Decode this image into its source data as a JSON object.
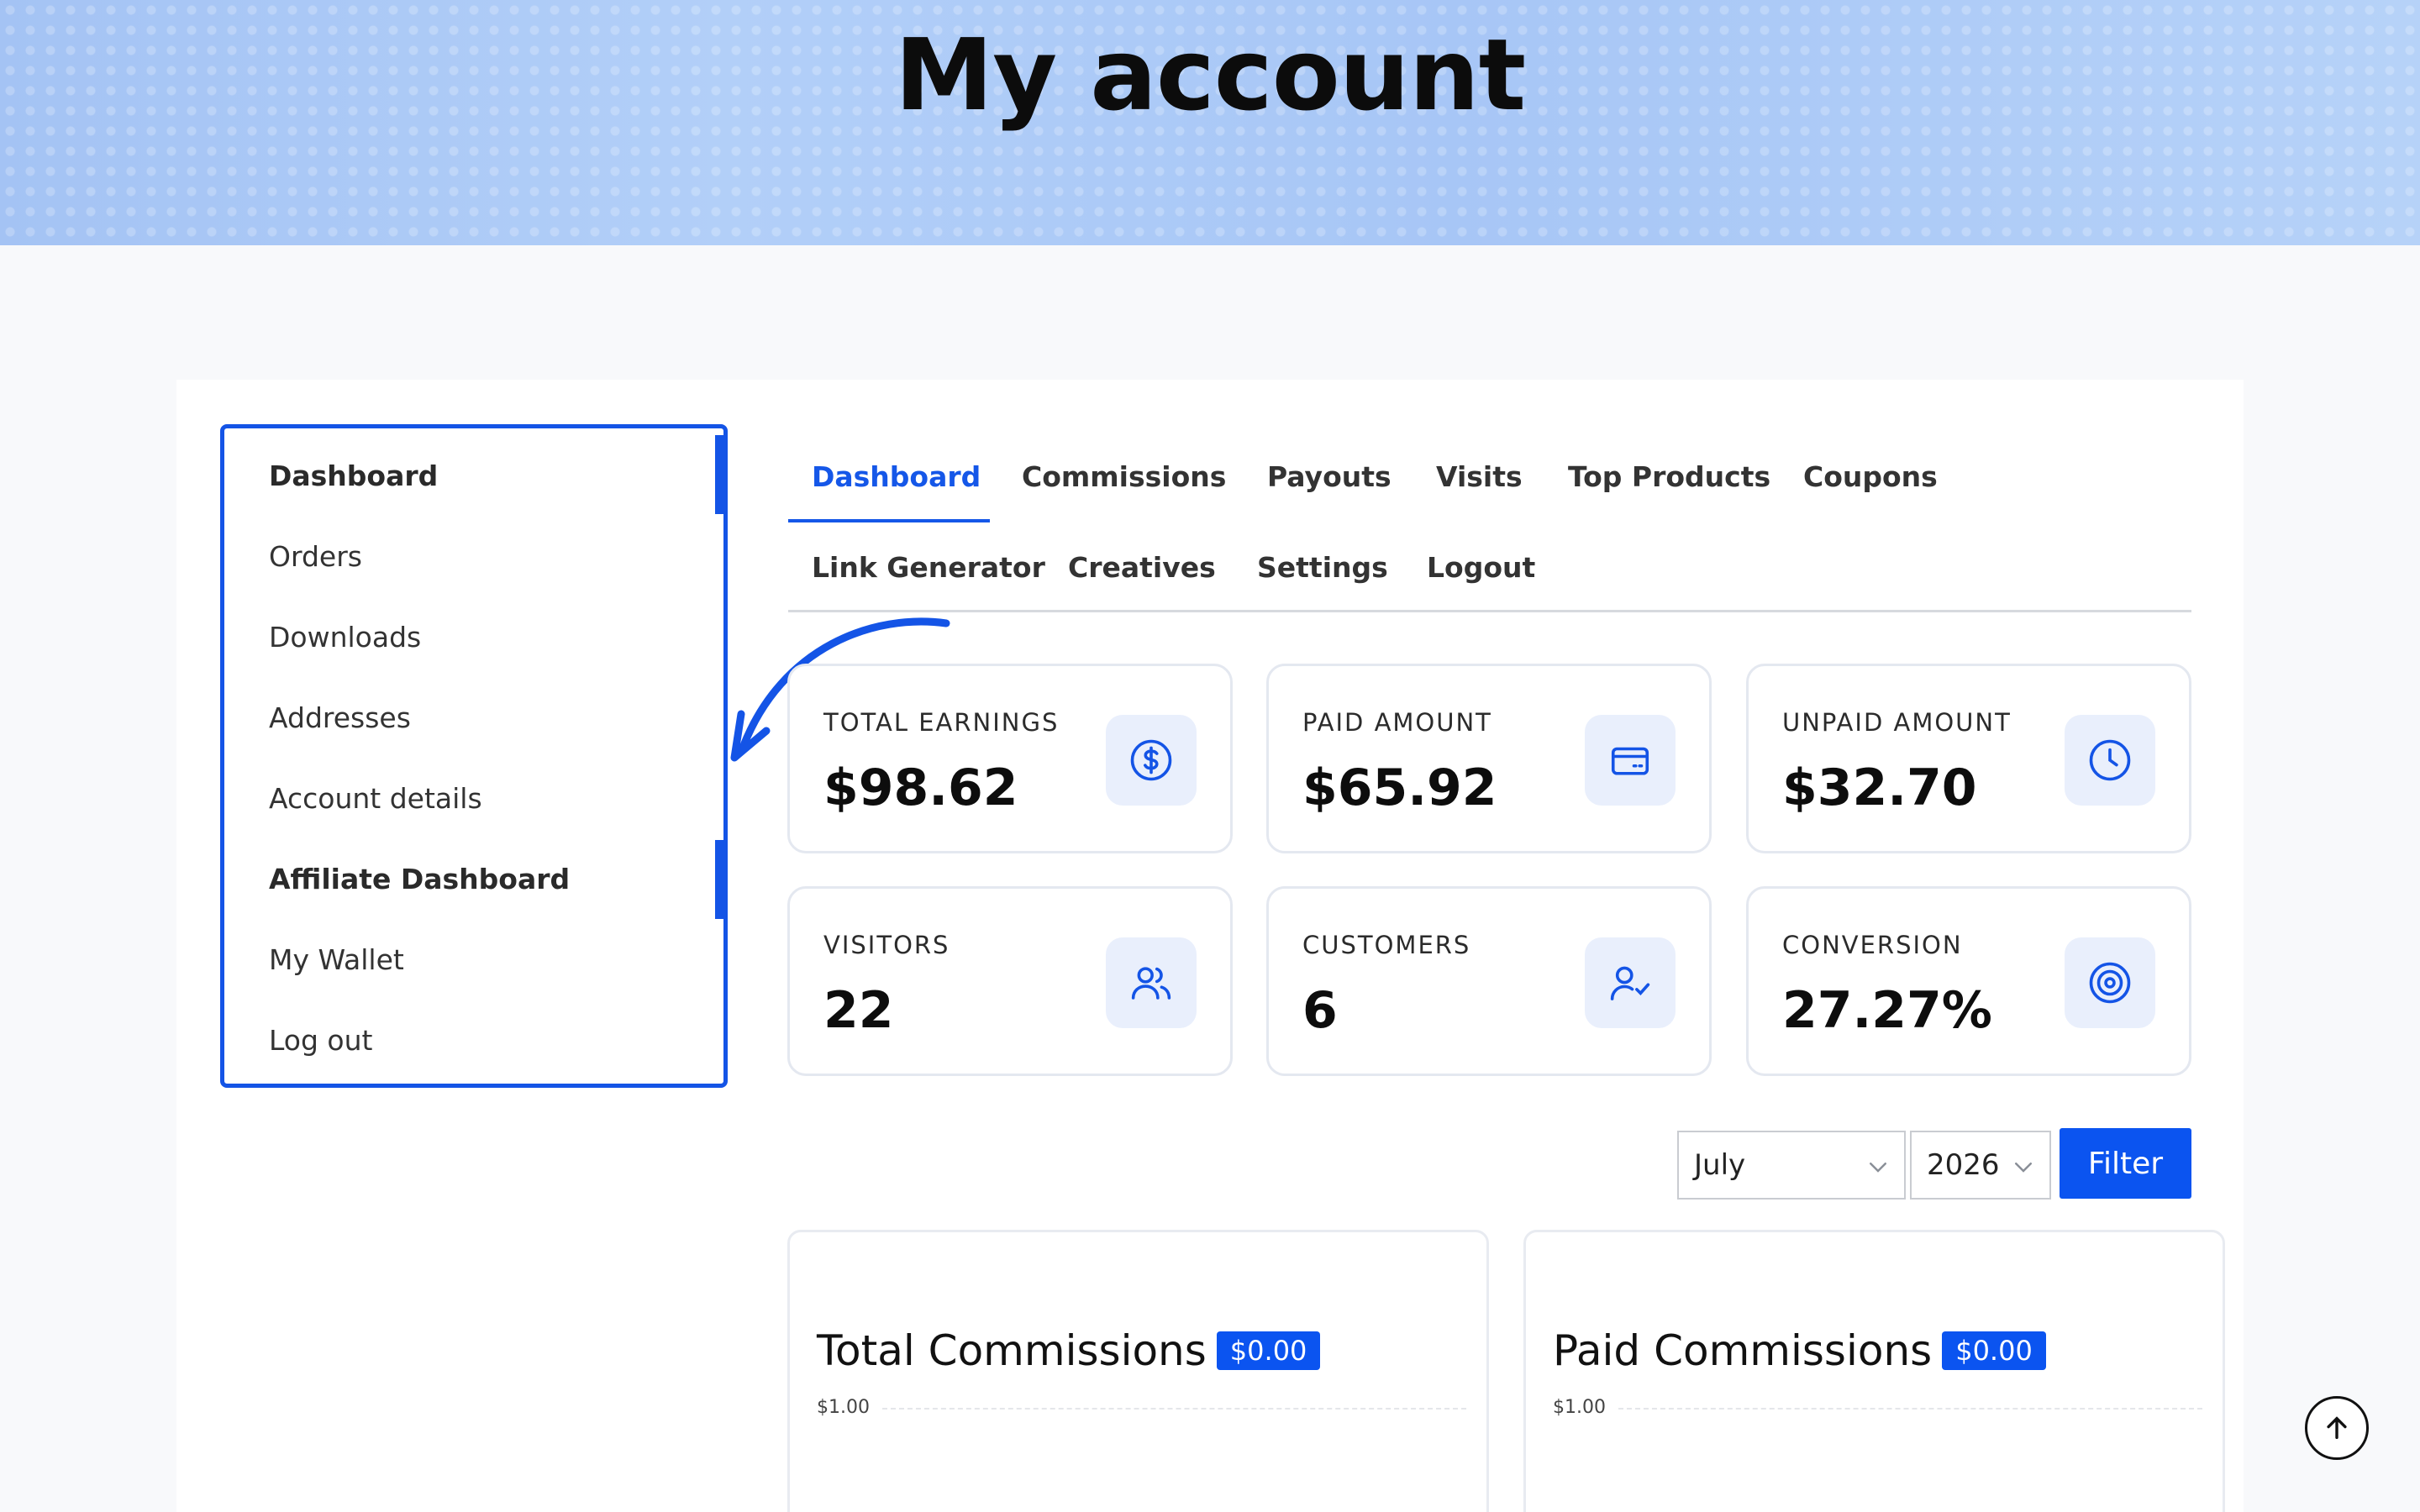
{
  "hero": {
    "title": "My account"
  },
  "sidebar": {
    "items": [
      {
        "label": "Dashboard"
      },
      {
        "label": "Orders"
      },
      {
        "label": "Downloads"
      },
      {
        "label": "Addresses"
      },
      {
        "label": "Account details"
      },
      {
        "label": "Affiliate Dashboard"
      },
      {
        "label": "My Wallet"
      },
      {
        "label": "Log out"
      }
    ]
  },
  "tabs": {
    "row1": [
      "Dashboard",
      "Commissions",
      "Payouts",
      "Visits",
      "Top Products",
      "Coupons"
    ],
    "row2": [
      "Link Generator",
      "Creatives",
      "Settings",
      "Logout"
    ],
    "active": "Dashboard"
  },
  "stats": [
    {
      "label": "TOTAL EARNINGS",
      "value": "$98.62",
      "icon": "dollar-circle-icon"
    },
    {
      "label": "PAID AMOUNT",
      "value": "$65.92",
      "icon": "credit-card-icon"
    },
    {
      "label": "UNPAID AMOUNT",
      "value": "$32.70",
      "icon": "clock-icon"
    },
    {
      "label": "VISITORS",
      "value": "22",
      "icon": "users-icon"
    },
    {
      "label": "CUSTOMERS",
      "value": "6",
      "icon": "user-check-icon"
    },
    {
      "label": "CONVERSION",
      "value": "27.27%",
      "icon": "target-icon"
    }
  ],
  "filter": {
    "month": "July",
    "year": "2026",
    "button_label": "Filter"
  },
  "charts": [
    {
      "title": "Total Commissions",
      "badge": "$0.00",
      "tick": "$1.00"
    },
    {
      "title": "Paid Commissions",
      "badge": "$0.00",
      "tick": "$1.00"
    }
  ],
  "colors": {
    "accent": "#1454e6",
    "button": "#0b54f0",
    "icon_bg": "#e9effc"
  }
}
